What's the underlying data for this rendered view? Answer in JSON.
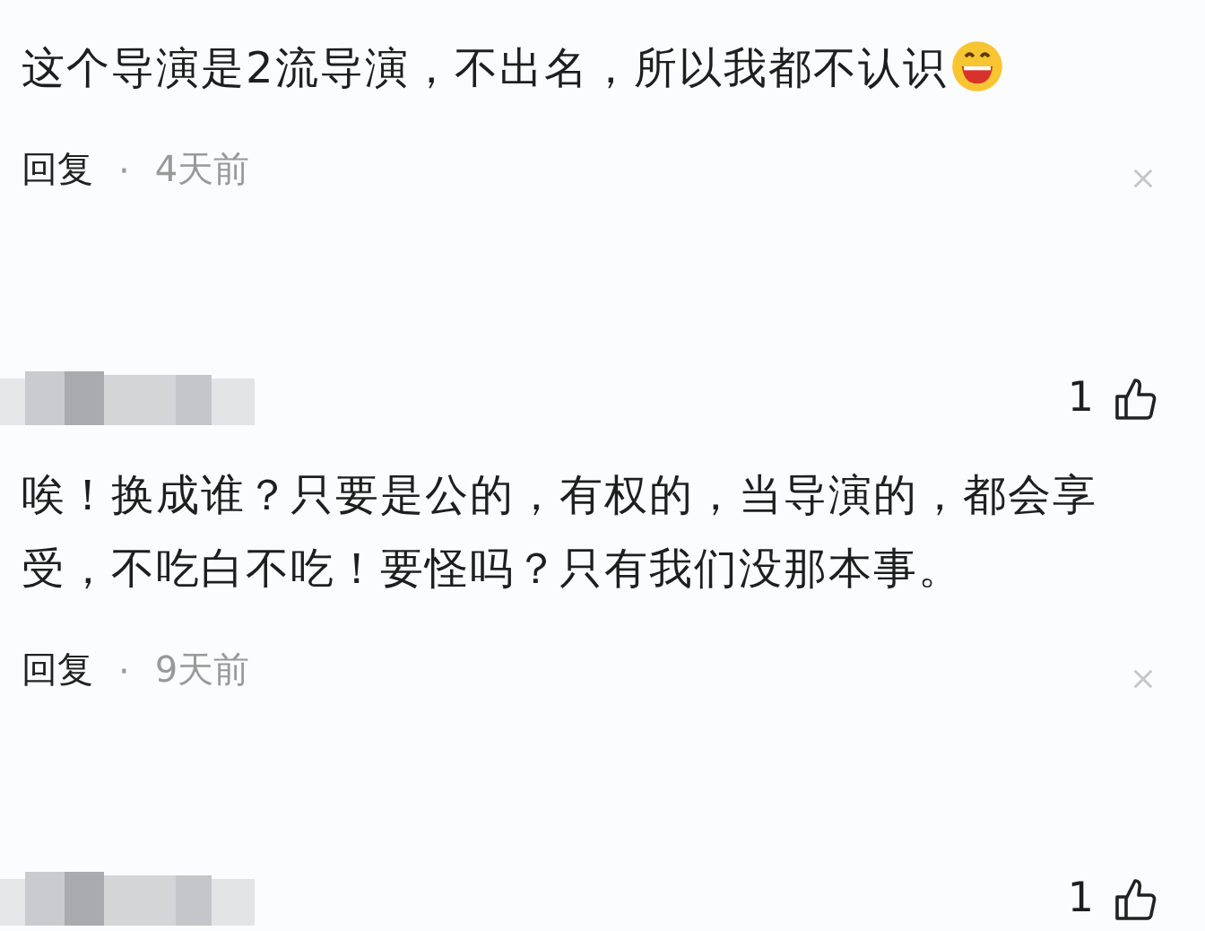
{
  "comments": [
    {
      "author_blurred": false,
      "text": "这个导演是2流导演，不出名，所以我都不认识",
      "emoji": true,
      "reply": "回复",
      "separator": "·",
      "time": "4天前"
    },
    {
      "author_blurred": true,
      "likes": "1",
      "text": "唉！换成谁？只要是公的，有权的，当导演的，都会享受，不吃白不吃！要怪吗？只有我们没那本事。",
      "emoji": false,
      "reply": "回复",
      "separator": "·",
      "time": "9天前"
    },
    {
      "author_blurred": true,
      "likes": "1"
    }
  ]
}
